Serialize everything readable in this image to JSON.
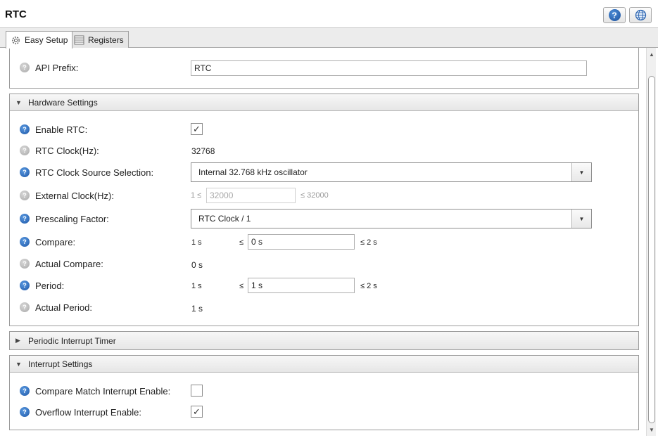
{
  "window": {
    "title": "RTC",
    "help_button": "?",
    "web_button_icon": "globe-icon"
  },
  "tabs": [
    {
      "label": "Easy Setup",
      "icon": "gear-icon",
      "active": true
    },
    {
      "label": "Registers",
      "icon": "table-icon",
      "active": false
    }
  ],
  "general": {
    "api_prefix_label": "API Prefix:",
    "api_prefix_value": "RTC"
  },
  "hardware": {
    "header": "Hardware Settings",
    "enable_rtc_label": "Enable RTC:",
    "enable_rtc_checked": true,
    "rtc_clock_label": "RTC Clock(Hz):",
    "rtc_clock_value": "32768",
    "clock_source_label": "RTC Clock Source Selection:",
    "clock_source_value": "Internal 32.768 kHz oscillator",
    "external_clock_label": "External Clock(Hz):",
    "external_clock_min": "1 ≤",
    "external_clock_value": "32000",
    "external_clock_max": "≤ 32000",
    "prescaling_label": "Prescaling Factor:",
    "prescaling_value": "RTC Clock / 1",
    "compare_label": "Compare:",
    "compare_min": "1 s",
    "compare_le": "≤",
    "compare_value": "0 s",
    "compare_max": "≤ 2 s",
    "actual_compare_label": "Actual Compare:",
    "actual_compare_value": "0 s",
    "period_label": "Period:",
    "period_min": "1 s",
    "period_le": "≤",
    "period_value": "1 s",
    "period_max": "≤ 2 s",
    "actual_period_label": "Actual Period:",
    "actual_period_value": "1 s"
  },
  "pit": {
    "header": "Periodic Interrupt Timer"
  },
  "interrupts": {
    "header": "Interrupt Settings",
    "compare_match_label": "Compare Match Interrupt Enable:",
    "compare_match_checked": false,
    "overflow_label": "Overflow Interrupt Enable:",
    "overflow_checked": true
  },
  "glyphs": {
    "help": "?",
    "check": "✓",
    "expanded": "▼",
    "collapsed": "▶",
    "dropdown": "▼"
  }
}
